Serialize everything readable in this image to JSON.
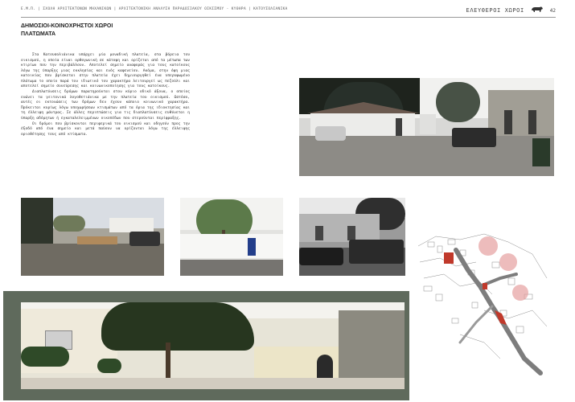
{
  "header": {
    "left_text": "Ε.Μ.Π. | ΣΧΟΛΗ ΑΡΧΙΤΕΚΤΟΝΩΝ ΜΗΧΑΝΙΚΩΝ | ΑΡΧΙΤΕΚΤΟΝΙΚΗ ΑΝΑΛΥΣΗ ΠΑΡΑΔΟΣΙΑΚΟΥ ΟΙΚΙΣΜΟΥ - ΚΥΘΗΡΑ | ΚΑΤΟΥΣΟΛΙΑΝΙΚΑ",
    "section": "ΕΛΕΥΘΕΡΟΙ ΧΩΡΟΙ",
    "page_number": "42",
    "icon": "animal-emblem-icon"
  },
  "title": {
    "line1": "ΔΗΜΟΣΙΟΙ-ΚΟΙΝΟΧΡΗΣΤΟΙ ΧΩΡΟΙ",
    "line2": "ΠΛΑΤΩΜΑΤΑ"
  },
  "body": {
    "paragraphs": [
      "Στα Κατουσολιάνικα υπάρχει μία μοναδική πλατεία, στα βόρεια του οικισμού, η οποία είναι ορθογωνική σε κάτοψη και ορίζεται από τα μέτωπα των κτιρίων που την περιβάλλουν. Αποτελεί σημείο αναφοράς για τους κατοίκους λόγω της ύπαρξης μιας εκκλησίας και ενός καφενείου. Ακόμα, στην όψη μιας κατοικίας που βρίσκεται στην πλατεία έχει δημιουργηθεί ένα υπερυψωμένο πλάτωμα το οποίο παρά τον ιδιωτικό του χαρακτήρα λειτουργεί ως πεζούλι και αποτελεί σημείο συνεύρεσης και κοινωνικοποίησης για τους κατοίκους.",
      "Διαπλατύνσεις δρόμων παρατηρούνται στον κύριο οδικό άξονα, ο οποίος ενώνει τα γειτονικά λογοθετιάνικα με την πλατεία του οικισμού. Ωστόσο, αυτές οι εκτονώσεις των δρόμων δεν έχουν κάποιο κοινωνικό χαρακτήρα. Πρόκειται κυρίως λόγω υποχωρήσεων κτισμάτων από τα όρια της ιδιοκτησίας και τη έλλειψη μάντρας. Σε άλλες περιπτώσεις για τις διαπλατύνσεις ευθύνεται η ύπαρξη αδόμητων ή εγκαταλελειμμένων οικοπέδων που στερούνται περίφραξης.",
      "Οι δρόμοι που βρίσκονται περιφερικά του οικισμού και οδηγούν προς την έξοδό από ένα σημείο και μετά παύουν να ορίζονται λόγω της έλλειψης οριοθέτησης τους από κτίσματα."
    ]
  },
  "colors": {
    "plan_band": "#5f6a5c",
    "highlight_red": "#c0392b",
    "highlight_pink": "#e6a0a0",
    "road_gray": "#8c8c8c"
  }
}
